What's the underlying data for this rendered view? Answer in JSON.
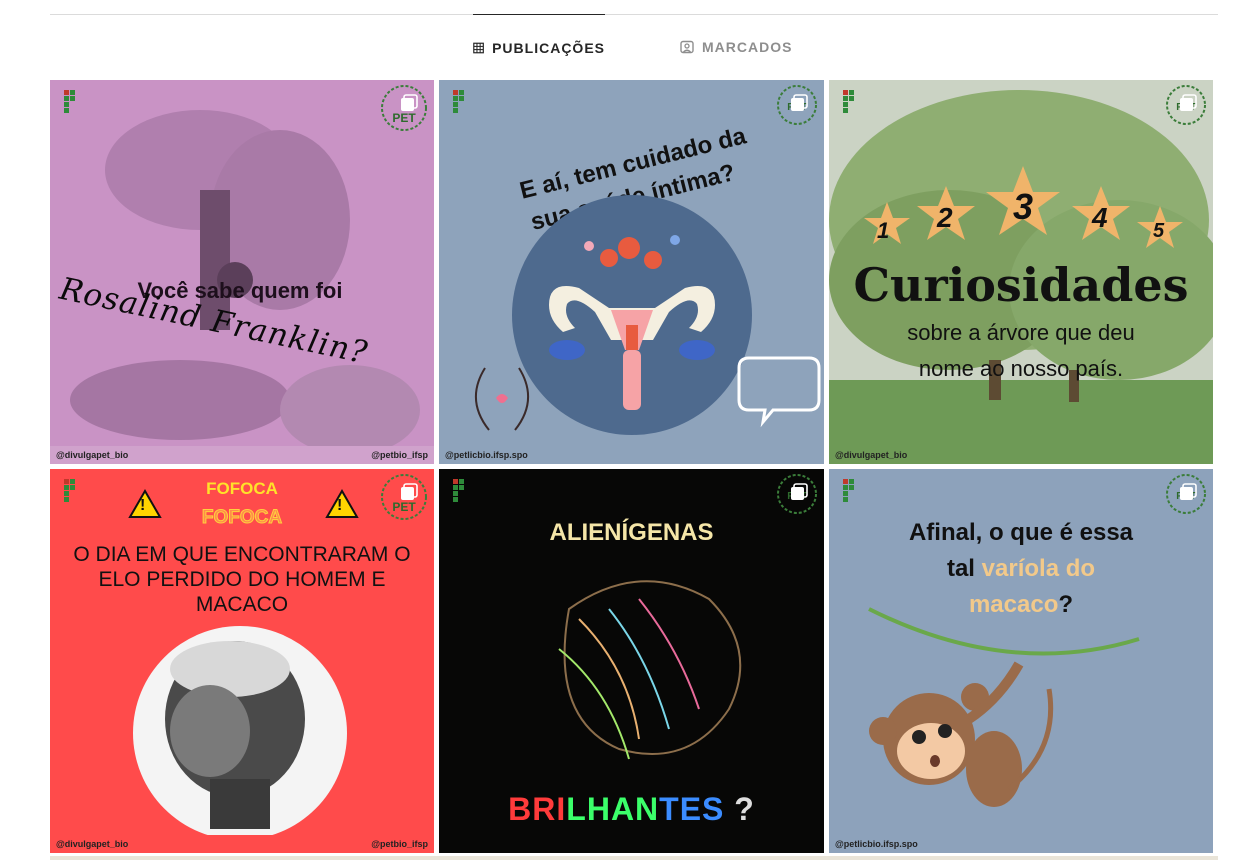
{
  "tabs": {
    "posts_label": "PUBLICAÇÕES",
    "tagged_label": "MARCADOS"
  },
  "posts": [
    {
      "logo_text": "INSTITUTO FEDERAL",
      "line1": "Você sabe quem foi",
      "line2": "Rosalind Franklin?",
      "handle_left": "@divulgapet_bio",
      "handle_right": "@petbio_ifsp"
    },
    {
      "logo_text": "INSTITUTO FEDERAL",
      "line1": "E aí, tem cuidado da",
      "line2": "sua saúde íntima?",
      "handle_left": "@petlicbio.ifsp.spo"
    },
    {
      "logo_text": "INSTITUTO FEDERAL",
      "stars": [
        "1",
        "2",
        "3",
        "4",
        "5"
      ],
      "title": "Curiosidades",
      "line1": "sobre a árvore que deu",
      "line2": "nome ao nosso país.",
      "handle_left": "@divulgapet_bio"
    },
    {
      "logo_text": "INSTITUTO FEDERAL",
      "kicker": "FOFOCA",
      "kicker2": "FOFOCA",
      "warning": "!",
      "line1": "O DIA EM QUE ENCONTRARAM O",
      "line2": "ELO PERDIDO DO HOMEM E",
      "line3": "MACACO",
      "handle_left": "@divulgapet_bio",
      "handle_right": "@petbio_ifsp"
    },
    {
      "logo_text": "INSTITUTO FEDERAL",
      "line1": "ALIENÍGENAS",
      "bri": "BRI",
      "lhan": "LHAN",
      "tes": "TES",
      "q": "?"
    },
    {
      "logo_text": "INSTITUTO FEDERAL",
      "line1": "Afinal, o que é essa",
      "line2a": "tal ",
      "line2b": "varíola do",
      "line3a": "macaco",
      "line3b": "?",
      "handle_left": "@petlicbio.ifsp.spo"
    }
  ],
  "colors": {
    "tab_active": "#262626",
    "tab_inactive": "#8e8e8e"
  }
}
